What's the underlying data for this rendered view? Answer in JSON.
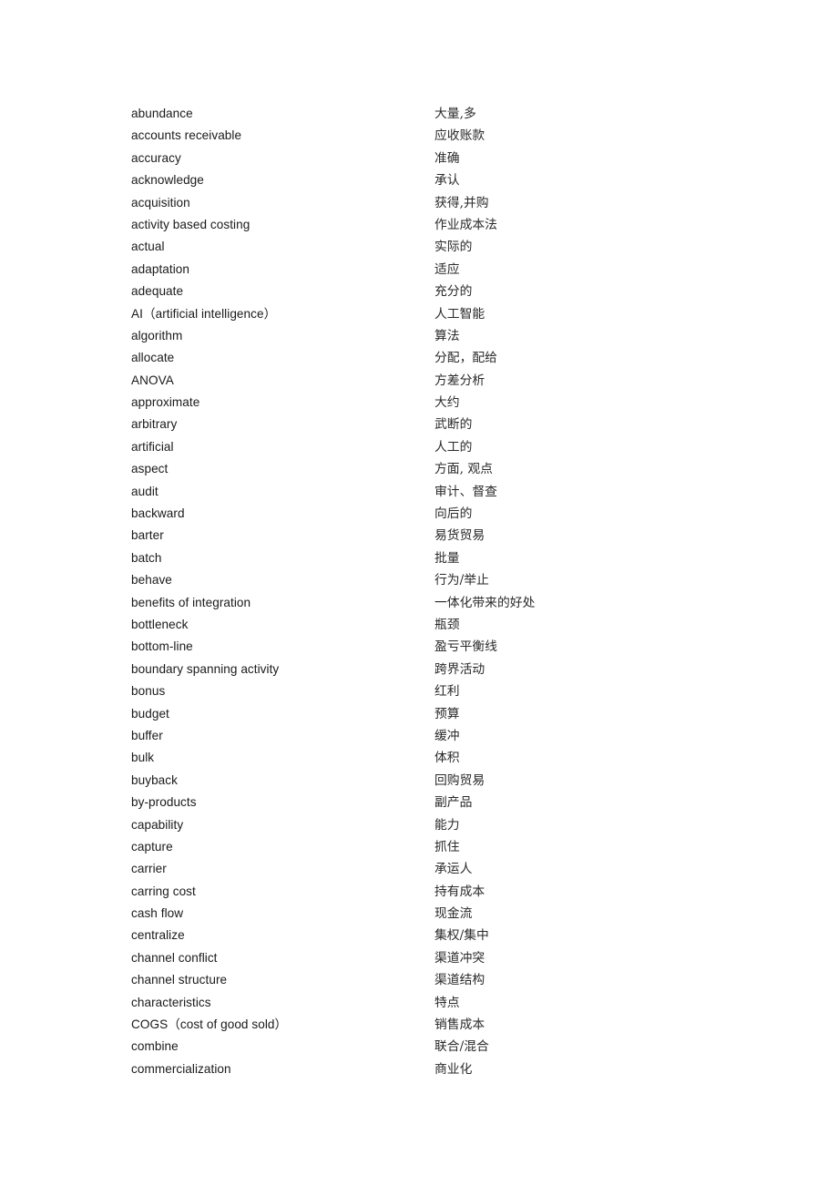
{
  "document": {
    "type": "bilingual-glossary",
    "columns": {
      "term_header": "",
      "translation_header": ""
    },
    "entries": [
      {
        "term": "abundance",
        "translation": "大量,多"
      },
      {
        "term": "accounts receivable",
        "translation": "应收账款"
      },
      {
        "term": "accuracy",
        "translation": "准确"
      },
      {
        "term": "acknowledge",
        "translation": "承认"
      },
      {
        "term": "acquisition",
        "translation": "获得,并购"
      },
      {
        "term": "activity based costing",
        "translation": "作业成本法"
      },
      {
        "term": "actual",
        "translation": "实际的"
      },
      {
        "term": "adaptation",
        "translation": "适应"
      },
      {
        "term": "adequate",
        "translation": "充分的"
      },
      {
        "term": "AI（artificial intelligence）",
        "translation": "人工智能"
      },
      {
        "term": "algorithm",
        "translation": "算法"
      },
      {
        "term": "allocate",
        "translation": "分配，配给"
      },
      {
        "term": "ANOVA",
        "translation": "方差分析"
      },
      {
        "term": "approximate",
        "translation": "大约"
      },
      {
        "term": "arbitrary",
        "translation": "武断的"
      },
      {
        "term": "artificial",
        "translation": "人工的"
      },
      {
        "term": "aspect",
        "translation": "方面, 观点"
      },
      {
        "term": "audit",
        "translation": "审计、督查"
      },
      {
        "term": "backward",
        "translation": "向后的"
      },
      {
        "term": "barter",
        "translation": "易货贸易"
      },
      {
        "term": "batch",
        "translation": "批量"
      },
      {
        "term": "behave",
        "translation": "行为/举止"
      },
      {
        "term": "benefits of integration",
        "translation": "一体化带来的好处"
      },
      {
        "term": "bottleneck",
        "translation": "瓶颈"
      },
      {
        "term": "bottom-line",
        "translation": "盈亏平衡线"
      },
      {
        "term": "boundary spanning activity",
        "translation": "跨界活动"
      },
      {
        "term": "bonus",
        "translation": "红利"
      },
      {
        "term": "budget",
        "translation": "预算"
      },
      {
        "term": "buffer",
        "translation": "缓冲"
      },
      {
        "term": "bulk",
        "translation": "体积"
      },
      {
        "term": "buyback",
        "translation": "回购贸易"
      },
      {
        "term": "by-products",
        "translation": "副产品"
      },
      {
        "term": "capability",
        "translation": "能力"
      },
      {
        "term": "capture",
        "translation": "抓住"
      },
      {
        "term": "carrier",
        "translation": "承运人"
      },
      {
        "term": "carring cost",
        "translation": "持有成本"
      },
      {
        "term": "cash flow",
        "translation": "现金流"
      },
      {
        "term": "centralize",
        "translation": "集权/集中"
      },
      {
        "term": "channel conflict",
        "translation": "渠道冲突"
      },
      {
        "term": "channel structure",
        "translation": "渠道结构"
      },
      {
        "term": "characteristics",
        "translation": "特点"
      },
      {
        "term": "COGS（cost of good sold）",
        "translation": "销售成本"
      },
      {
        "term": "combine",
        "translation": "联合/混合"
      },
      {
        "term": "commercialization",
        "translation": "商业化"
      }
    ]
  }
}
